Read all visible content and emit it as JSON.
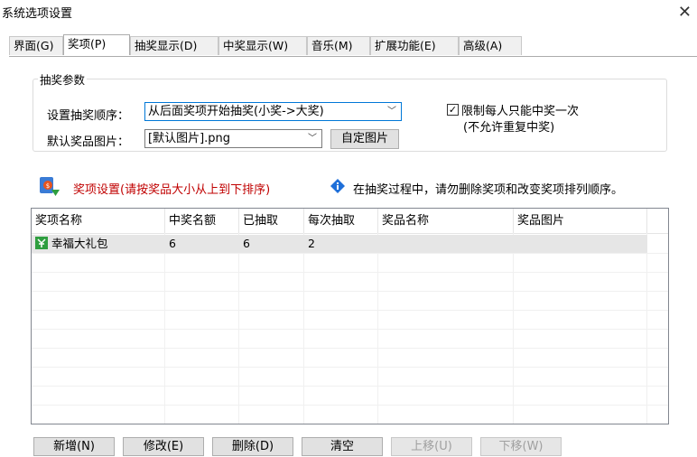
{
  "window": {
    "title": "系统选项设置",
    "close_symbol": "✕"
  },
  "tabs": [
    "界面(G)",
    "奖项(P)",
    "抽奖显示(D)",
    "中奖显示(W)",
    "音乐(M)",
    "扩展功能(E)",
    "高级(A)"
  ],
  "active_tab": "奖项(P)",
  "lottery_params": {
    "legend": "抽奖参数",
    "order_label": "设置抽奖顺序：",
    "order_value": "从后面奖项开始抽奖(小奖->大奖)",
    "image_label": "默认奖品图片：",
    "image_value": "[默认图片].png",
    "custom_image_button": "自定图片",
    "limit_checkbox_label": "限制每人只能中奖一次",
    "limit_checkbox_sublabel": "(不允许重复中奖)",
    "limit_checked": true
  },
  "prize_settings": {
    "heading": "奖项设置(请按奖品大小从上到下排序)",
    "info_text": "在抽奖过程中，请勿删除奖项和改变奖项排列顺序。",
    "heading_color": "#c00000"
  },
  "table": {
    "columns": [
      "奖项名称",
      "中奖名额",
      "已抽取",
      "每次抽取",
      "奖品名称",
      "奖品图片"
    ],
    "rows": [
      {
        "name": "幸福大礼包",
        "quota": "6",
        "drawn": "6",
        "per_draw": "2",
        "prize_name": "",
        "prize_image": "",
        "icon": "prize-icon"
      }
    ]
  },
  "buttons": {
    "add": "新增(N)",
    "edit": "修改(E)",
    "delete": "删除(D)",
    "clear": "清空",
    "move_up": "上移(U)",
    "move_down": "下移(W)"
  },
  "colors": {
    "focus_border": "#0078d7",
    "selected_row": "#e6e6e6"
  }
}
